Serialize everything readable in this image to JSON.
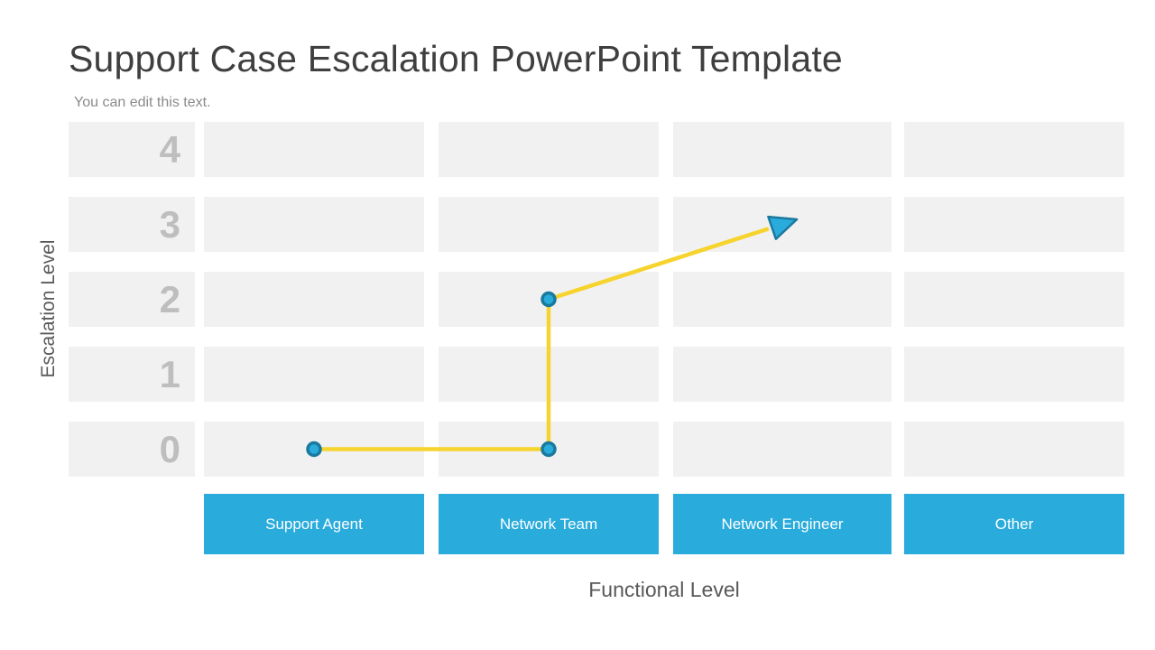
{
  "slide": {
    "title": "Support Case Escalation PowerPoint Template",
    "subtitle": "You can edit this text."
  },
  "axes": {
    "y_title": "Escalation Level",
    "x_title": "Functional Level"
  },
  "colors": {
    "accent_blue": "#29abdc",
    "marker_ring": "#1a7a9e",
    "flow_yellow": "#f6d32d",
    "cell_grey": "#f1f1f1",
    "level_number_grey": "#bebebe",
    "title_grey": "#3f3f3f",
    "subtitle_grey": "#8a8a8a",
    "axis_title_grey": "#595959"
  },
  "chart_data": {
    "type": "scatter",
    "title": "Support Case Escalation PowerPoint Template",
    "subtitle": "You can edit this text.",
    "xlabel": "Functional Level",
    "ylabel": "Escalation Level",
    "grid": true,
    "legend": "none",
    "categories": [
      "Support Agent",
      "Network Team",
      "Network Engineer",
      "Other"
    ],
    "levels": [
      "4",
      "3",
      "2",
      "1",
      "0"
    ],
    "ylim": [
      0,
      4
    ],
    "path": {
      "points": [
        {
          "category": "Support Agent",
          "level": 0,
          "marker": true
        },
        {
          "category": "Network Team",
          "level": 0,
          "marker": true
        },
        {
          "category": "Network Team",
          "level": 2,
          "marker": true
        },
        {
          "category": "Network Engineer",
          "level": 3,
          "marker": false,
          "arrowhead": true
        }
      ],
      "line_color": "#f6d32d",
      "marker_fill": "#29abdc",
      "marker_stroke": "#1a7a9e",
      "arrowhead_fill": "#29abdc",
      "arrowhead_stroke": "#1a7a9e"
    }
  },
  "levels": [
    {
      "label": "4"
    },
    {
      "label": "3"
    },
    {
      "label": "2"
    },
    {
      "label": "1"
    },
    {
      "label": "0"
    }
  ],
  "columns": [
    {
      "label": "Support Agent"
    },
    {
      "label": "Network Team"
    },
    {
      "label": "Network Engineer"
    },
    {
      "label": "Other"
    }
  ]
}
